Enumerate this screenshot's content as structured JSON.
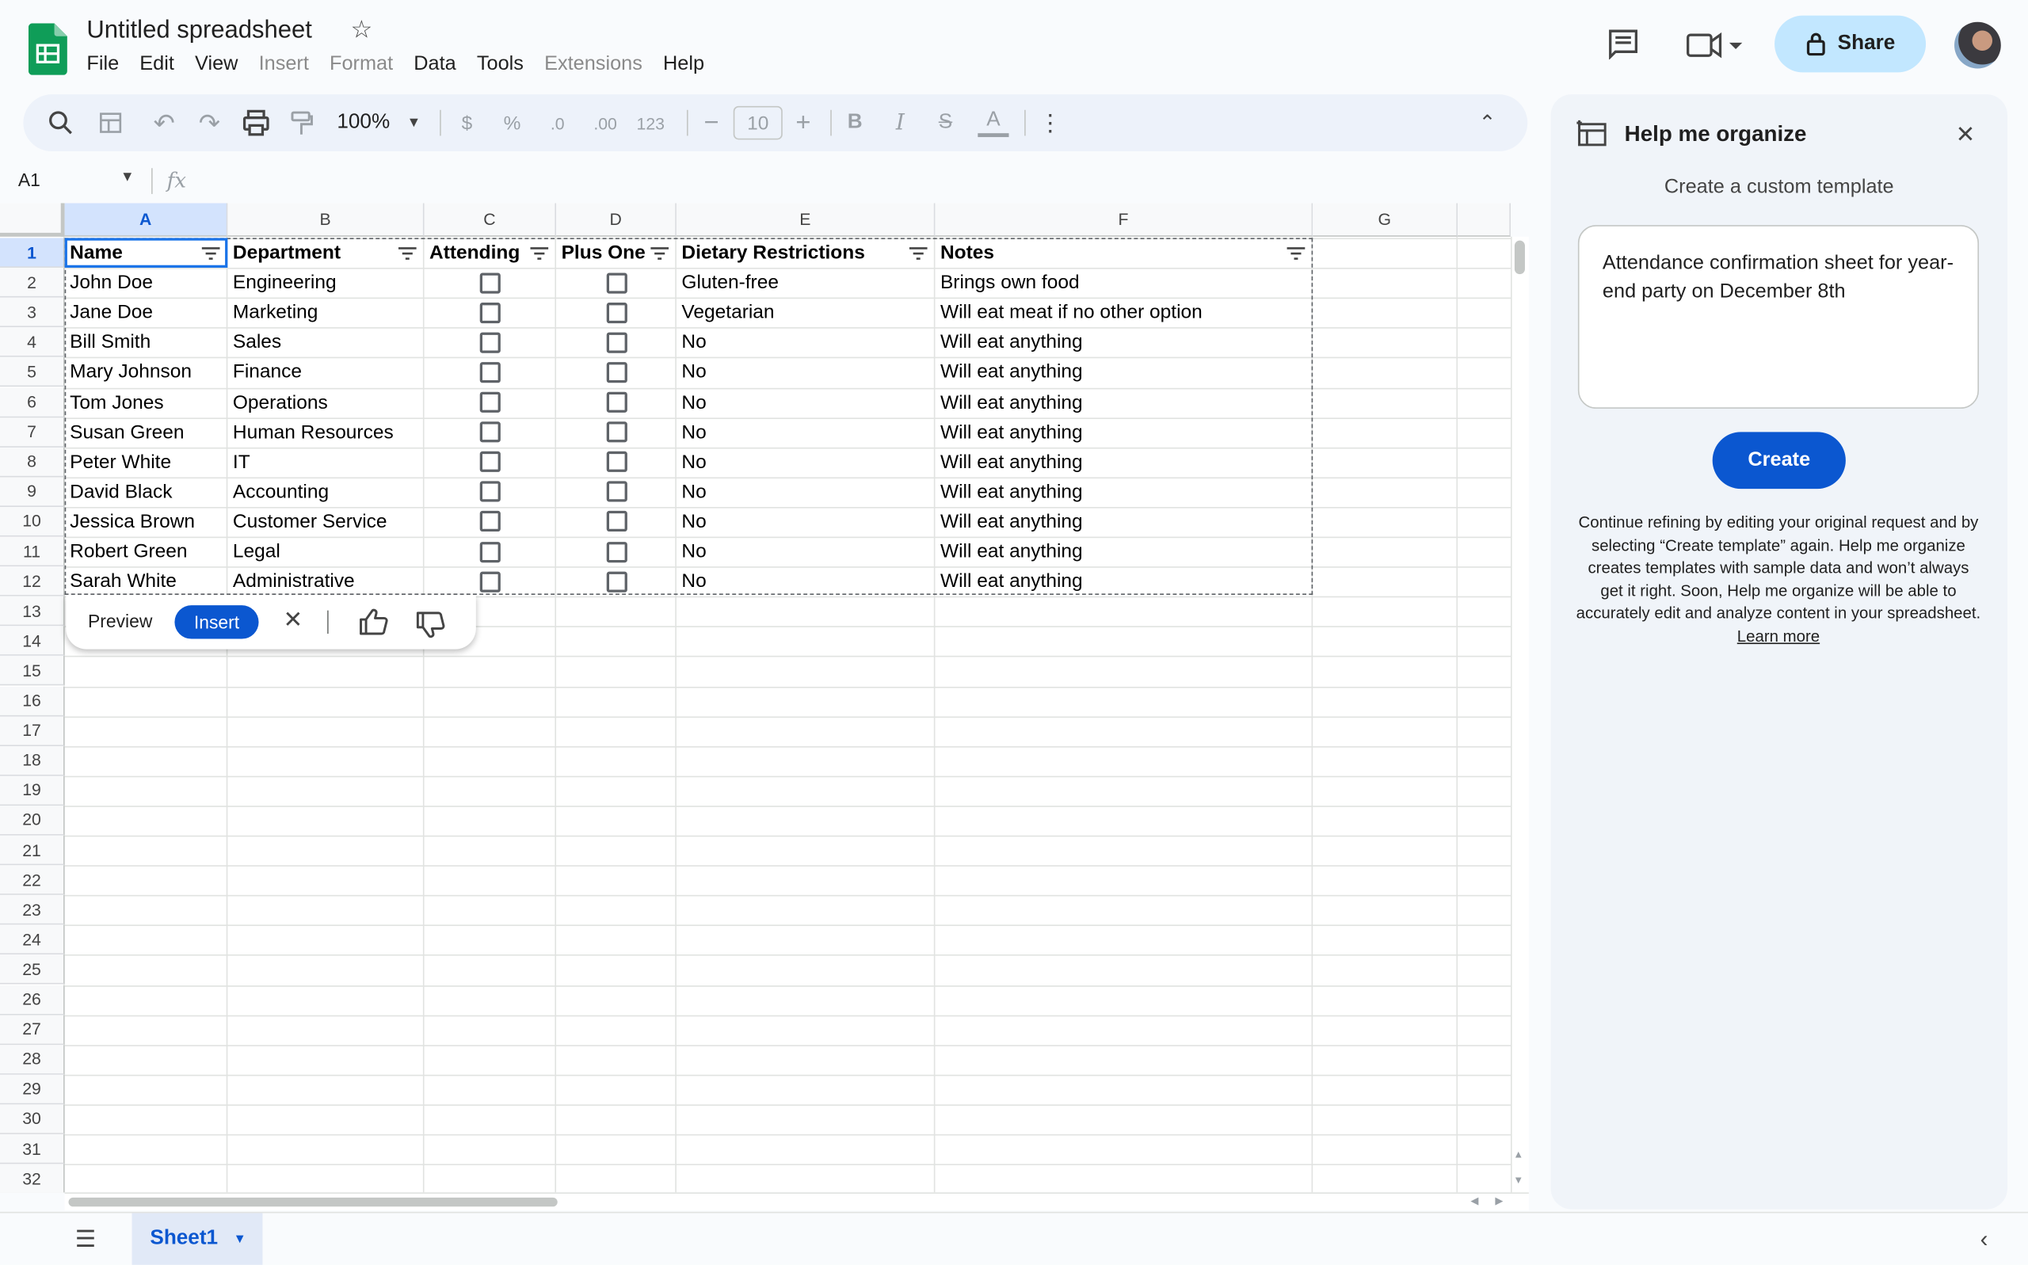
{
  "header": {
    "title": "Untitled spreadsheet",
    "share_label": "Share",
    "menu": [
      "File",
      "Edit",
      "View",
      "Insert",
      "Format",
      "Data",
      "Tools",
      "Extensions",
      "Help"
    ]
  },
  "toolbar": {
    "zoom": "100%",
    "currency": "$",
    "percent": "%",
    "dec_decrease": ".0",
    "dec_increase": ".00",
    "number_format": "123",
    "font_size": "10"
  },
  "formula_bar": {
    "name_box": "A1",
    "fx": "fx"
  },
  "grid": {
    "columns": [
      "A",
      "B",
      "C",
      "D",
      "E",
      "F",
      "G"
    ],
    "rows": [
      "1",
      "2",
      "3",
      "4",
      "5",
      "6",
      "7",
      "8",
      "9",
      "10",
      "11",
      "12",
      "13",
      "14",
      "15",
      "16",
      "17",
      "18",
      "19",
      "20",
      "21",
      "22",
      "23",
      "24",
      "25",
      "26",
      "27",
      "28",
      "29",
      "30",
      "31",
      "32"
    ],
    "headers": [
      "Name",
      "Department",
      "Attending",
      "Plus One",
      "Dietary Restrictions",
      "Notes"
    ],
    "data": [
      {
        "name": "John Doe",
        "dept": "Engineering",
        "diet": "Gluten-free",
        "notes": "Brings own food"
      },
      {
        "name": "Jane Doe",
        "dept": "Marketing",
        "diet": "Vegetarian",
        "notes": "Will eat meat if no other option"
      },
      {
        "name": "Bill Smith",
        "dept": "Sales",
        "diet": "No",
        "notes": "Will eat anything"
      },
      {
        "name": "Mary Johnson",
        "dept": "Finance",
        "diet": "No",
        "notes": "Will eat anything"
      },
      {
        "name": "Tom Jones",
        "dept": "Operations",
        "diet": "No",
        "notes": "Will eat anything"
      },
      {
        "name": "Susan Green",
        "dept": "Human Resources",
        "diet": "No",
        "notes": "Will eat anything"
      },
      {
        "name": "Peter White",
        "dept": "IT",
        "diet": "No",
        "notes": "Will eat anything"
      },
      {
        "name": "David Black",
        "dept": "Accounting",
        "diet": "No",
        "notes": "Will eat anything"
      },
      {
        "name": "Jessica Brown",
        "dept": "Customer Service",
        "diet": "No",
        "notes": "Will eat anything"
      },
      {
        "name": "Robert Green",
        "dept": "Legal",
        "diet": "No",
        "notes": "Will eat anything"
      },
      {
        "name": "Sarah White",
        "dept": "Administrative",
        "diet": "No",
        "notes": "Will eat anything"
      }
    ]
  },
  "preview_bar": {
    "preview_label": "Preview",
    "insert_label": "Insert"
  },
  "sheet_tabs": {
    "active": "Sheet1"
  },
  "panel": {
    "title": "Help me organize",
    "subtitle": "Create a custom template",
    "prompt": "Attendance confirmation sheet for year-end party on December 8th",
    "create_label": "Create",
    "note": "Continue refining by editing your original request and by selecting “Create template” again. Help me organize creates templates with sample data and won’t always get it right. Soon, Help me organize will be able to accurately edit and analyze content in your spreadsheet.",
    "learn_more": "Learn more"
  }
}
